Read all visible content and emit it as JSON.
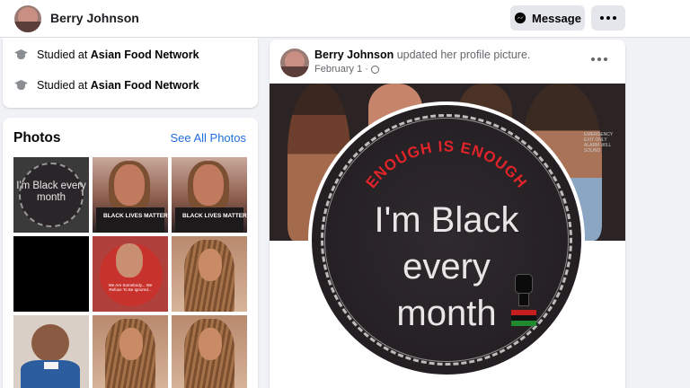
{
  "header": {
    "profile_name": "Berry Johnson",
    "message_label": "Message"
  },
  "intro": {
    "items": [
      {
        "prefix": "Studied at ",
        "place": "Asian Food Network"
      },
      {
        "prefix": "Studied at ",
        "place": "Asian Food Network"
      }
    ]
  },
  "photos": {
    "title": "Photos",
    "see_all": "See All Photos",
    "tile1_text": "I'm Black every month",
    "tile2_banner": "BLACK LIVES MATTER",
    "tile3_banner": "BLACK LIVES MATTER",
    "tile5_text": "We Are Somebody... We Refuse To Be Ignored..."
  },
  "post": {
    "author": "Berry Johnson",
    "action": " updated her profile picture.",
    "date": "February 1 ·",
    "profile_arc_text": "ENOUGH IS ENOUGH",
    "profile_text_l1": "I'm Black",
    "profile_text_l2": "every",
    "profile_text_l3": "month",
    "cover_plaque": "EMERGENCY EXIT ONLY ALARM WILL SOUND"
  },
  "colors": {
    "link": "#216fdb",
    "background": "#f0f2f5",
    "button_bg": "#e4e6eb",
    "arc_text": "#e0242a"
  }
}
